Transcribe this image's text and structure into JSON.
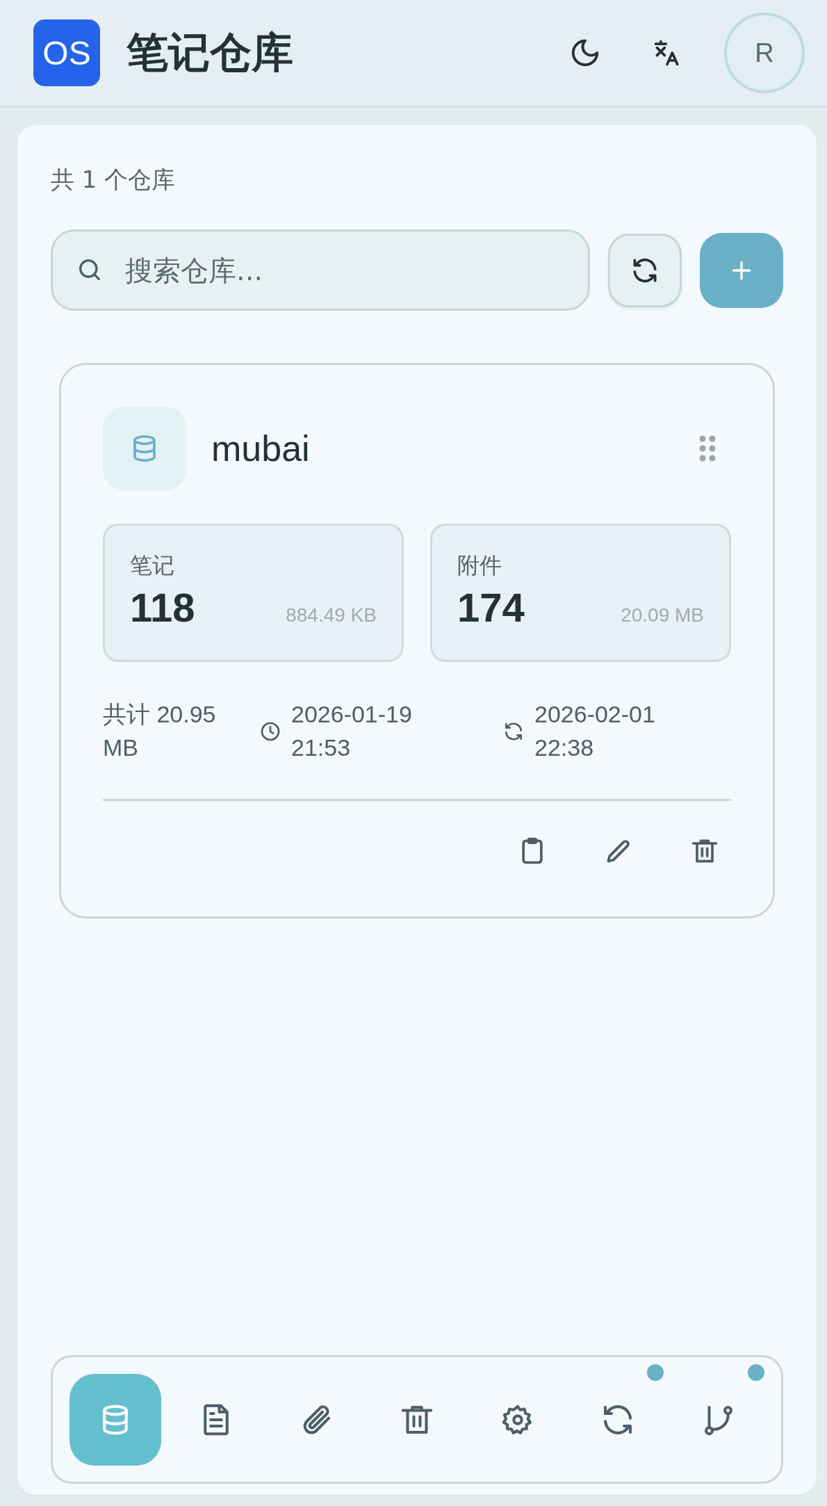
{
  "header": {
    "logo": "OS",
    "title": "笔记仓库",
    "avatar": "R"
  },
  "summary": "共 1 个仓库",
  "search": {
    "placeholder": "搜索仓库..."
  },
  "repositories": [
    {
      "name": "mubai",
      "stats": [
        {
          "label": "笔记",
          "count": "118",
          "size": "884.49 KB"
        },
        {
          "label": "附件",
          "count": "174",
          "size": "20.09 MB"
        }
      ],
      "total": "共计 20.95 MB",
      "created": "2026-01-19 21:53",
      "synced": "2026-02-01 22:38"
    }
  ],
  "nav": [
    {
      "kind": "repos",
      "selected": true,
      "badge": false
    },
    {
      "kind": "notes",
      "selected": false,
      "badge": false
    },
    {
      "kind": "attachments",
      "selected": false,
      "badge": false
    },
    {
      "kind": "trash",
      "selected": false,
      "badge": false
    },
    {
      "kind": "settings",
      "selected": false,
      "badge": false
    },
    {
      "kind": "sync",
      "selected": false,
      "badge": true
    },
    {
      "kind": "git",
      "selected": false,
      "badge": true
    }
  ]
}
